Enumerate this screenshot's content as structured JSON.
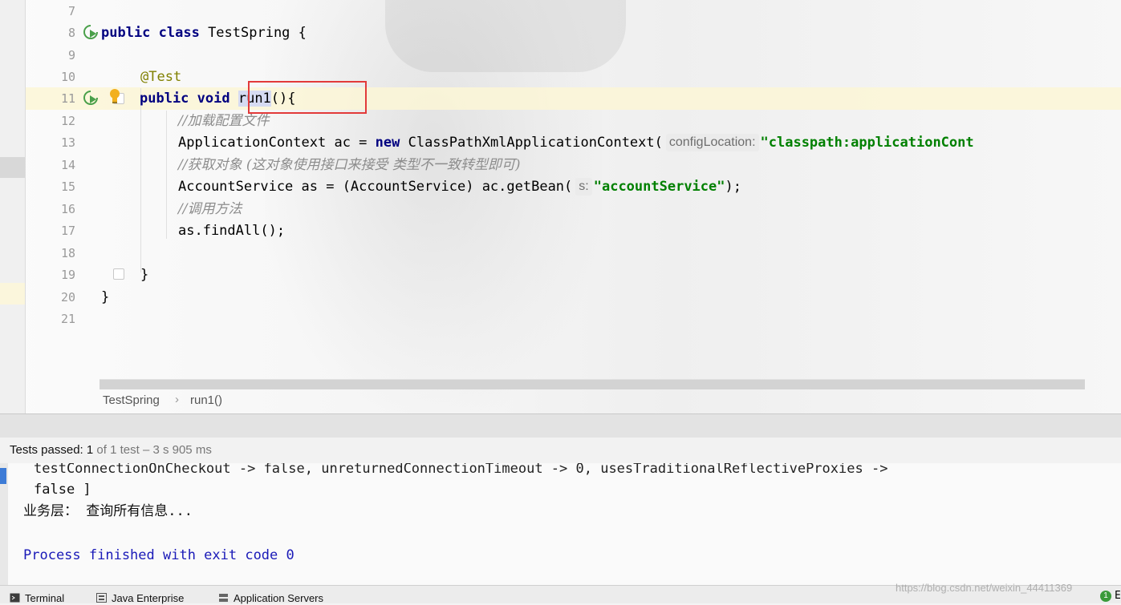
{
  "editor": {
    "line_numbers": [
      "7",
      "8",
      "9",
      "10",
      "11",
      "12",
      "13",
      "14",
      "15",
      "16",
      "17",
      "18",
      "19",
      "20",
      "21"
    ],
    "lines": {
      "l8": {
        "kw": "public class",
        "rest": " TestSpring {"
      },
      "l10": {
        "annotation": "@Test"
      },
      "l11": {
        "kw": "public void",
        "method": "run1",
        "rest": "(){"
      },
      "l12": {
        "comment": "//加载配置文件"
      },
      "l13": {
        "pre": "ApplicationContext ac = ",
        "kw": "new",
        "mid": " ClassPathXmlApplicationContext(",
        "hint": "configLocation:",
        "str": "\"classpath:applicationCont"
      },
      "l14": {
        "comment": "//获取对象 (这对象使用接口来接受 类型不一致转型即可)"
      },
      "l15": {
        "pre": "AccountService as = (AccountService) ac.getBean(",
        "hint": "s:",
        "str": "\"accountService\"",
        "post": ");"
      },
      "l16": {
        "comment": "//调用方法"
      },
      "l17": {
        "pre": "as.findAll();"
      },
      "l19": {
        "pre": "}"
      },
      "l20": {
        "pre": "}"
      }
    }
  },
  "breadcrumb": {
    "class": "TestSpring",
    "method": "run1()"
  },
  "tests": {
    "label": "Tests passed:",
    "count": "1",
    "detail": "of 1 test – 3 s 905 ms"
  },
  "console": {
    "cut_line": "testConnectionOnCheckout -> false, unreturnedConnectionTimeout -> 0, usesTraditionalReflectiveProxies ->",
    "line1": "false ]",
    "line2": "业务层： 查询所有信息...",
    "line3": "Process finished with exit code 0"
  },
  "statusbar": {
    "terminal": "Terminal",
    "java_enterprise": "Java Enterprise",
    "app_servers": "Application Servers",
    "event_count": "1",
    "event_label": "E",
    "watermark": "https://blog.csdn.net/weixin_44411369"
  },
  "colors": {
    "keyword": "#000080",
    "string": "#008000",
    "annotation": "#808000",
    "comment": "#8c8c8c",
    "highlight_box": "#e23a3a"
  }
}
